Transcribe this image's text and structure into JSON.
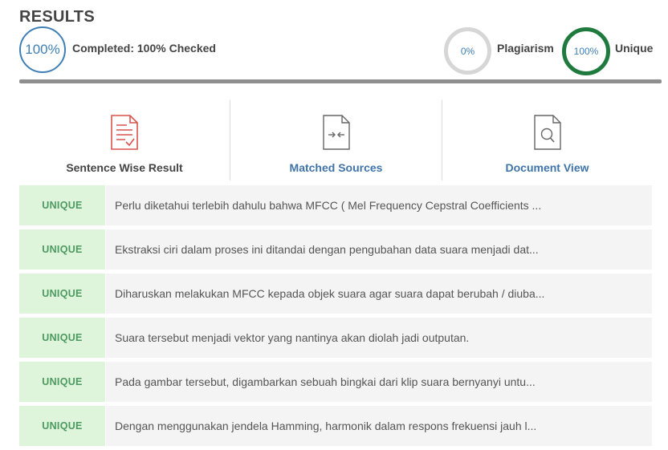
{
  "header": {
    "title": "RESULTS",
    "completed_percent": "100%",
    "completed_label": "Completed: 100% Checked",
    "plagiarism_percent": "0%",
    "plagiarism_label": "Plagiarism",
    "unique_percent": "100%",
    "unique_label": "Unique",
    "progress_fraction": 1.0
  },
  "tabs": [
    {
      "label": "Sentence Wise Result",
      "icon": "document-check-icon"
    },
    {
      "label": "Matched Sources",
      "icon": "document-compare-icon"
    },
    {
      "label": "Document View",
      "icon": "document-search-icon"
    }
  ],
  "rows": [
    {
      "status": "UNIQUE",
      "text": "Perlu diketahui terlebih dahulu bahwa MFCC ( Mel Frequency Cepstral Coefficients ..."
    },
    {
      "status": "UNIQUE",
      "text": "Ekstraksi ciri dalam proses ini ditandai dengan pengubahan data suara menjadi dat..."
    },
    {
      "status": "UNIQUE",
      "text": "Diharuskan melakukan MFCC kepada objek suara agar suara dapat berubah / diuba..."
    },
    {
      "status": "UNIQUE",
      "text": "Suara tersebut menjadi vektor yang nantinya akan diolah jadi outputan."
    },
    {
      "status": "UNIQUE",
      "text": "Pada gambar tersebut, digambarkan sebuah bingkai dari klip suara bernyanyi untu..."
    },
    {
      "status": "UNIQUE",
      "text": "Dengan menggunakan jendela Hamming, harmonik dalam respons frekuensi jauh l..."
    }
  ],
  "colors": {
    "accent_blue": "#3f7fb6",
    "unique_green": "#1f7a3e",
    "badge_bg": "#def5dc",
    "badge_text": "#4c9a5f"
  }
}
